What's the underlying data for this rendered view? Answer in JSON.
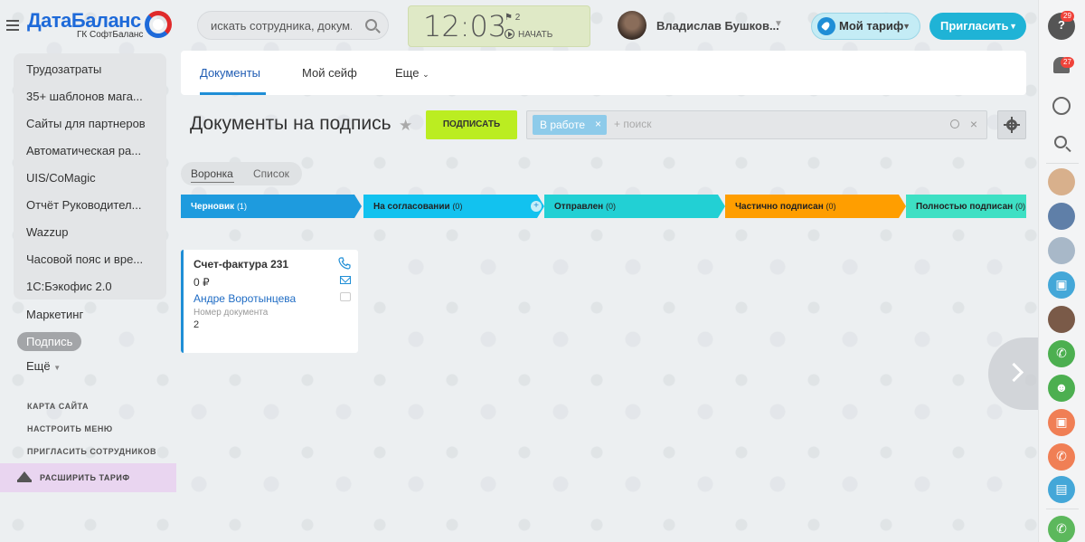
{
  "header": {
    "logo_title": "ДатаБаланс",
    "logo_subtitle": "ГК СофтБаланс",
    "search_placeholder": "искать сотрудника, докум...",
    "clock_time": "12:03",
    "clock_flag_count": "2",
    "clock_start_label": "НАЧАТЬ",
    "user_name": "Владислав Бушков...",
    "tariff_label": "Мой тариф",
    "invite_label": "Пригласить"
  },
  "left_menu": {
    "items": [
      {
        "label": "Трудозатраты"
      },
      {
        "label": "35+ шаблонов мага..."
      },
      {
        "label": "Сайты для партнеров"
      },
      {
        "label": "Автоматическая ра..."
      },
      {
        "label": "UIS/CoMagic"
      },
      {
        "label": "Отчёт Руководител..."
      },
      {
        "label": "Wazzup"
      },
      {
        "label": "Часовой пояс и вре..."
      },
      {
        "label": "1С:Бэкофис 2.0"
      }
    ],
    "marketing": "Маркетинг",
    "active": "Подпись",
    "more": "Ещё",
    "site_map": "КАРТА САЙТА",
    "configure_menu": "НАСТРОИТЬ МЕНЮ",
    "invite_employees": "ПРИГЛАСИТЬ СОТРУДНИКОВ",
    "expand_tariff": "РАСШИРИТЬ ТАРИФ"
  },
  "tabs": [
    {
      "label": "Документы"
    },
    {
      "label": "Мой сейф"
    },
    {
      "label": "Еще"
    }
  ],
  "page": {
    "title": "Документы на подпись",
    "sign_button": "ПОДПИСАТЬ",
    "filter_chip": "В работе",
    "filter_placeholder": "+ поиск"
  },
  "view": {
    "funnel": "Воронка",
    "list": "Список"
  },
  "stages": [
    {
      "label": "Черновик",
      "count": "(1)",
      "color": "#1e9bde",
      "text_color": "#ffffff"
    },
    {
      "label": "На согласовании",
      "count": "(0)",
      "color": "#12c2ef",
      "text_color": "#222222"
    },
    {
      "label": "Отправлен",
      "count": "(0)",
      "color": "#22d0d4",
      "text_color": "#222222"
    },
    {
      "label": "Частично подписан",
      "count": "(0)",
      "color": "#ff9e00",
      "text_color": "#222222"
    },
    {
      "label": "Полностью подписан",
      "count": "(0)",
      "color": "#3ee0c4",
      "text_color": "#222222"
    }
  ],
  "card": {
    "title": "Счет-фактура 231",
    "sum": "0 ₽",
    "client": "Андре Воротынцева",
    "field_label": "Номер документа",
    "field_value": "2"
  },
  "right_bar": {
    "help_badge": "29",
    "bell_badge": "27",
    "help_glyph": "?"
  }
}
